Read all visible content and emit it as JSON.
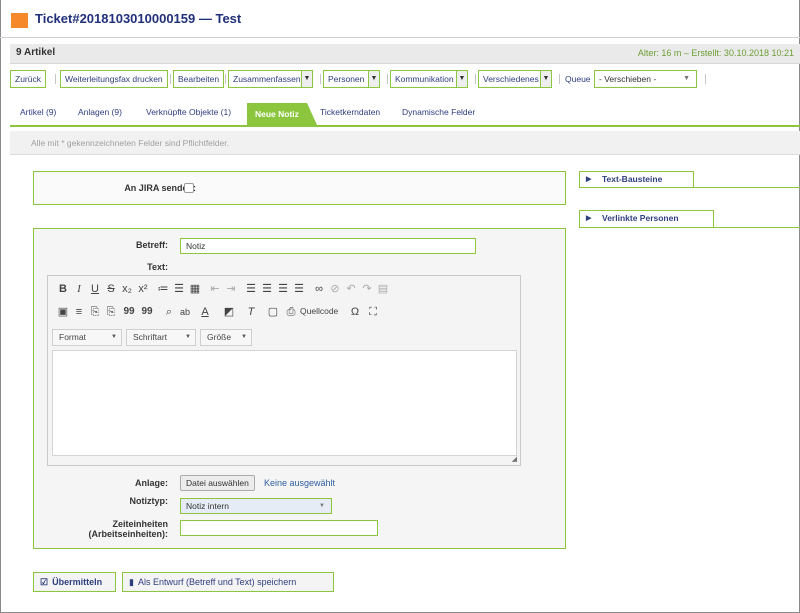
{
  "ticket": {
    "title": "Ticket#2018103010000159 — Test",
    "article_count": "9 Artikel",
    "age_info": "Alter: 16 m – Erstellt: 30.10.2018 10:21",
    "accent_color": "#f6892a"
  },
  "toolbar": {
    "back": "Zurück",
    "fax": "Weiterleitungsfax drucken",
    "edit": "Bearbeiten",
    "merge": "Zusammenfassen",
    "persons": "Personen",
    "communication": "Kommunikation",
    "misc": "Verschiedenes",
    "queue_label": "Queue",
    "queue_value": "- Verschieben -"
  },
  "tabs": [
    {
      "label": "Artikel (9)"
    },
    {
      "label": "Anlagen (9)"
    },
    {
      "label": "Verknüpfte Objekte (1)"
    },
    {
      "label": "Neue Notiz"
    },
    {
      "label": "Ticketkerndaten"
    },
    {
      "label": "Dynamische Felder"
    }
  ],
  "hint": "Alle mit * gekennzeichneten Felder sind Pflichtfelder.",
  "form": {
    "jira_label": "An JIRA senden:",
    "subject_label": "Betreff:",
    "subject_value": "Notiz",
    "text_label": "Text:",
    "editor": {
      "format": "Format",
      "font": "Schriftart",
      "size": "Größe",
      "source": "Quellcode"
    },
    "attachment_label": "Anlage:",
    "file_button": "Datei auswählen",
    "file_none": "Keine ausgewählt",
    "note_type_label": "Notiztyp:",
    "note_type_value": "Notiz intern",
    "time_units_label_1": "Zeiteinheiten",
    "time_units_label_2": "(Arbeitseinheiten):"
  },
  "sidebar": {
    "text_modules": "Text-Bausteine",
    "linked_persons": "Verlinkte Personen"
  },
  "buttons": {
    "submit": "Übermitteln",
    "draft": "Als Entwurf (Betreff und Text) speichern"
  },
  "colors": {
    "accent_green": "#8cc63f",
    "link_blue": "#2f3e7f"
  }
}
